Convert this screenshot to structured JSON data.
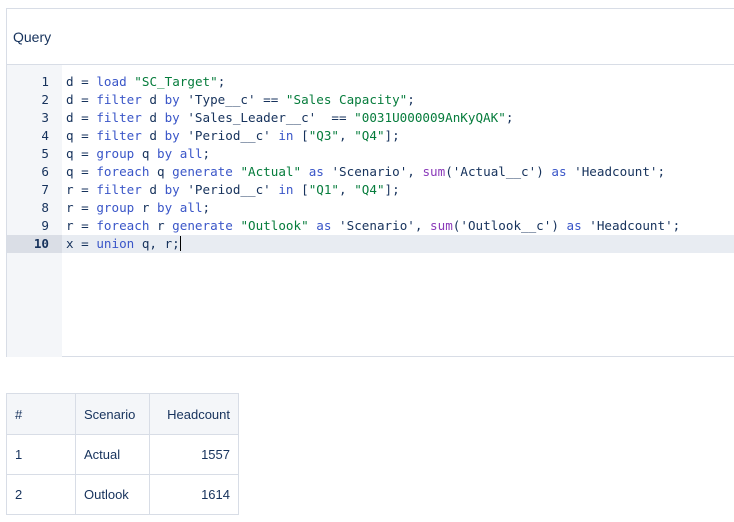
{
  "query": {
    "title": "Query",
    "active_line": 10,
    "lines": [
      [
        {
          "t": "d = ",
          "c": "plain"
        },
        {
          "t": "load",
          "c": "kw"
        },
        {
          "t": " ",
          "c": "plain"
        },
        {
          "t": "\"SC_Target\"",
          "c": "str"
        },
        {
          "t": ";",
          "c": "plain"
        }
      ],
      [
        {
          "t": "d = ",
          "c": "plain"
        },
        {
          "t": "filter",
          "c": "kw"
        },
        {
          "t": " d ",
          "c": "plain"
        },
        {
          "t": "by",
          "c": "kw"
        },
        {
          "t": " 'Type__c' == ",
          "c": "plain"
        },
        {
          "t": "\"Sales Capacity\"",
          "c": "str"
        },
        {
          "t": ";",
          "c": "plain"
        }
      ],
      [
        {
          "t": "d = ",
          "c": "plain"
        },
        {
          "t": "filter",
          "c": "kw"
        },
        {
          "t": " d ",
          "c": "plain"
        },
        {
          "t": "by",
          "c": "kw"
        },
        {
          "t": " 'Sales_Leader__c'  == ",
          "c": "plain"
        },
        {
          "t": "\"0031U000009AnKyQAK\"",
          "c": "str"
        },
        {
          "t": ";",
          "c": "plain"
        }
      ],
      [
        {
          "t": "q = ",
          "c": "plain"
        },
        {
          "t": "filter",
          "c": "kw"
        },
        {
          "t": " d ",
          "c": "plain"
        },
        {
          "t": "by",
          "c": "kw"
        },
        {
          "t": " 'Period__c' ",
          "c": "plain"
        },
        {
          "t": "in",
          "c": "kw"
        },
        {
          "t": " [",
          "c": "plain"
        },
        {
          "t": "\"Q3\"",
          "c": "str"
        },
        {
          "t": ", ",
          "c": "plain"
        },
        {
          "t": "\"Q4\"",
          "c": "str"
        },
        {
          "t": "];",
          "c": "plain"
        }
      ],
      [
        {
          "t": "q = ",
          "c": "plain"
        },
        {
          "t": "group",
          "c": "kw"
        },
        {
          "t": " q ",
          "c": "plain"
        },
        {
          "t": "by",
          "c": "kw"
        },
        {
          "t": " ",
          "c": "plain"
        },
        {
          "t": "all",
          "c": "kw"
        },
        {
          "t": ";",
          "c": "plain"
        }
      ],
      [
        {
          "t": "q = ",
          "c": "plain"
        },
        {
          "t": "foreach",
          "c": "kw"
        },
        {
          "t": " q ",
          "c": "plain"
        },
        {
          "t": "generate",
          "c": "kw"
        },
        {
          "t": " ",
          "c": "plain"
        },
        {
          "t": "\"Actual\"",
          "c": "str"
        },
        {
          "t": " ",
          "c": "plain"
        },
        {
          "t": "as",
          "c": "kw"
        },
        {
          "t": " 'Scenario', ",
          "c": "plain"
        },
        {
          "t": "sum",
          "c": "fn"
        },
        {
          "t": "('Actual__c') ",
          "c": "plain"
        },
        {
          "t": "as",
          "c": "kw"
        },
        {
          "t": " 'Headcount';",
          "c": "plain"
        }
      ],
      [
        {
          "t": "r = ",
          "c": "plain"
        },
        {
          "t": "filter",
          "c": "kw"
        },
        {
          "t": " d ",
          "c": "plain"
        },
        {
          "t": "by",
          "c": "kw"
        },
        {
          "t": " 'Period__c' ",
          "c": "plain"
        },
        {
          "t": "in",
          "c": "kw"
        },
        {
          "t": " [",
          "c": "plain"
        },
        {
          "t": "\"Q1\"",
          "c": "str"
        },
        {
          "t": ", ",
          "c": "plain"
        },
        {
          "t": "\"Q4\"",
          "c": "str"
        },
        {
          "t": "];",
          "c": "plain"
        }
      ],
      [
        {
          "t": "r = ",
          "c": "plain"
        },
        {
          "t": "group",
          "c": "kw"
        },
        {
          "t": " r ",
          "c": "plain"
        },
        {
          "t": "by",
          "c": "kw"
        },
        {
          "t": " ",
          "c": "plain"
        },
        {
          "t": "all",
          "c": "kw"
        },
        {
          "t": ";",
          "c": "plain"
        }
      ],
      [
        {
          "t": "r = ",
          "c": "plain"
        },
        {
          "t": "foreach",
          "c": "kw"
        },
        {
          "t": " r ",
          "c": "plain"
        },
        {
          "t": "generate",
          "c": "kw"
        },
        {
          "t": " ",
          "c": "plain"
        },
        {
          "t": "\"Outlook\"",
          "c": "str"
        },
        {
          "t": " ",
          "c": "plain"
        },
        {
          "t": "as",
          "c": "kw"
        },
        {
          "t": " 'Scenario', ",
          "c": "plain"
        },
        {
          "t": "sum",
          "c": "fn"
        },
        {
          "t": "('Outlook__c') ",
          "c": "plain"
        },
        {
          "t": "as",
          "c": "kw"
        },
        {
          "t": " 'Headcount';",
          "c": "plain"
        }
      ],
      [
        {
          "t": "x = ",
          "c": "plain"
        },
        {
          "t": "union",
          "c": "kw"
        },
        {
          "t": " q, r;",
          "c": "plain"
        }
      ]
    ]
  },
  "results": {
    "headers": {
      "index": "#",
      "scenario": "Scenario",
      "headcount": "Headcount"
    },
    "rows": [
      {
        "index": "1",
        "scenario": "Actual",
        "headcount": "1557"
      },
      {
        "index": "2",
        "scenario": "Outlook",
        "headcount": "1614"
      }
    ]
  },
  "colors": {
    "string": "#067c3c",
    "keyword": "#3a56c8",
    "function": "#8a3ab9",
    "text": "#16325c",
    "border": "#d8dde6"
  }
}
